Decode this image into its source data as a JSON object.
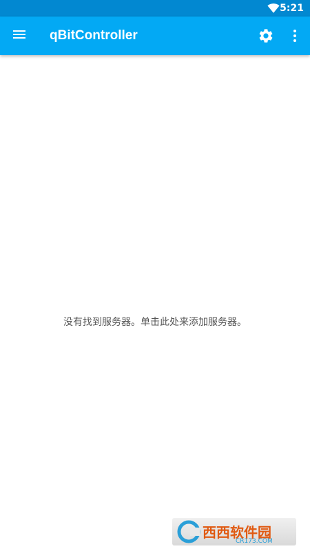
{
  "status_bar": {
    "time": "5:21",
    "wifi_icon": "wifi-icon"
  },
  "app_bar": {
    "title": "qBitController",
    "menu_icon": "menu-icon",
    "settings_icon": "gear-icon",
    "overflow_icon": "more-vert-icon",
    "color": "#03a9f4",
    "status_color": "#0288d1"
  },
  "main": {
    "empty_message": "没有找到服务器。单击此处来添加服务器。"
  },
  "watermark": {
    "brand": "西西软件园",
    "site": "CR173.COM"
  }
}
